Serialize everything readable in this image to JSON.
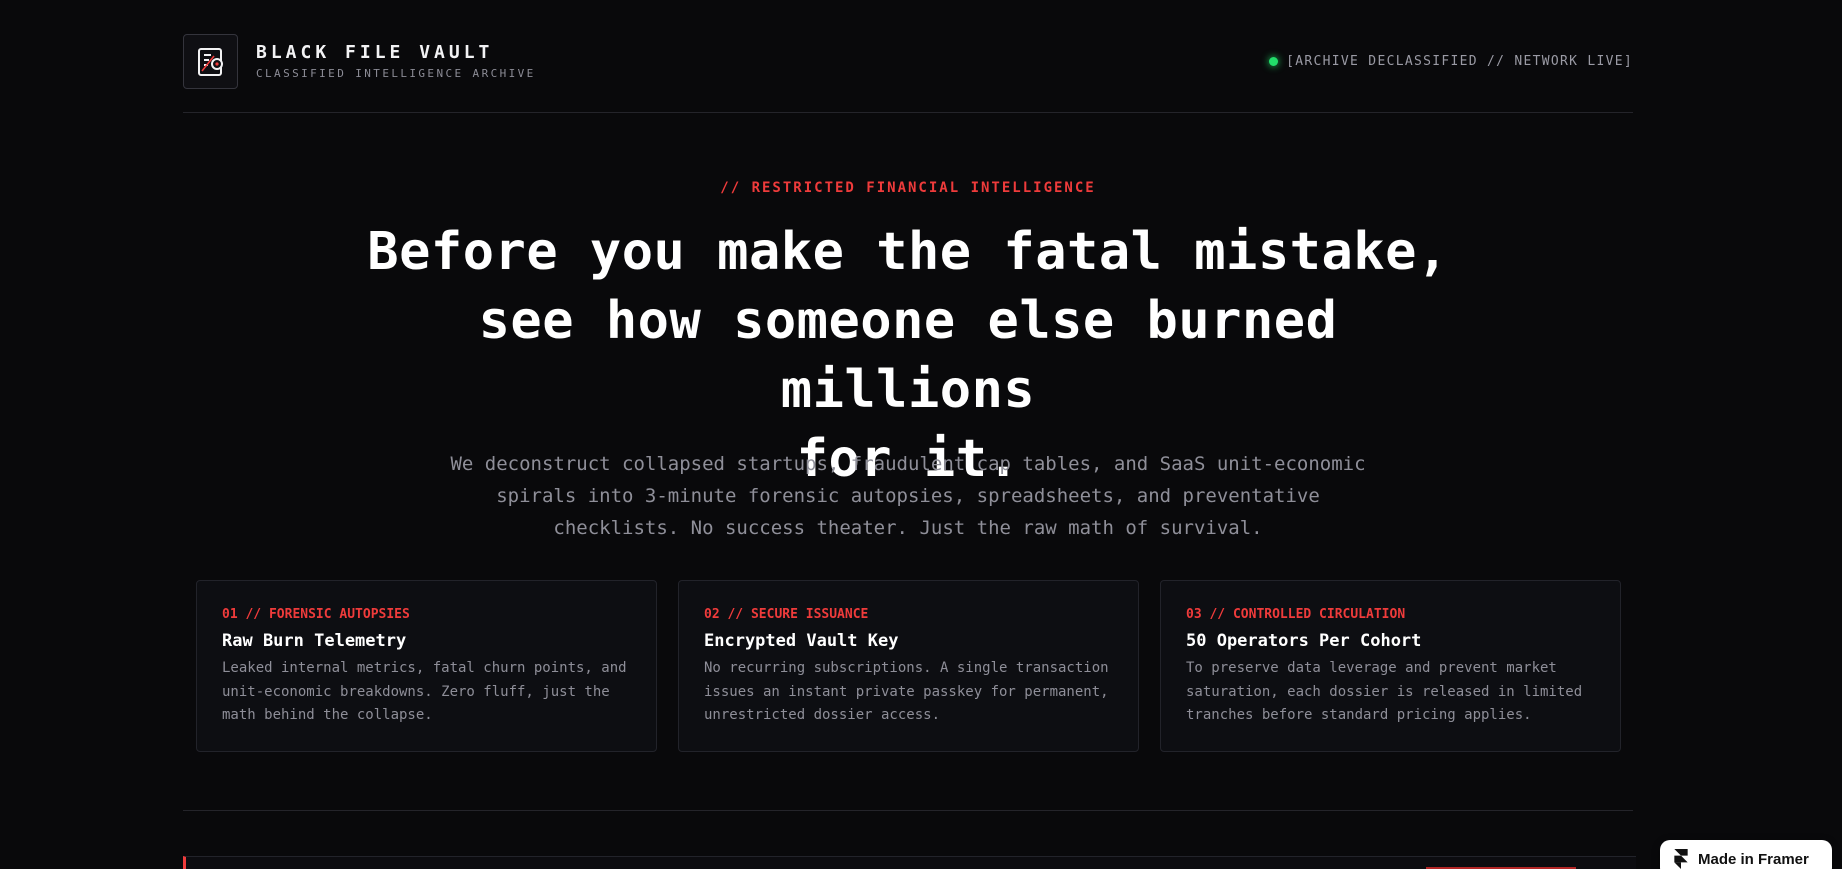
{
  "header": {
    "brand_title": "BLACK FILE VAULT",
    "brand_subtitle": "CLASSIFIED INTELLIGENCE ARCHIVE",
    "logo_icon": "file-dossier-icon",
    "status_text": "[ARCHIVE DECLASSIFIED // NETWORK LIVE]",
    "status_color": "#22dd6a"
  },
  "hero": {
    "eyebrow": "// RESTRICTED FINANCIAL INTELLIGENCE",
    "headline_line1": "Before you make the fatal mistake,",
    "headline_line2": "see how someone else burned millions",
    "headline_line3": "for it.",
    "lede": "We deconstruct collapsed startups, fraudulent cap tables, and SaaS unit-economic spirals into 3-minute forensic autopsies, spreadsheets, and preventative checklists. No success theater. Just the raw math of survival."
  },
  "cards": [
    {
      "tag": "01 // FORENSIC AUTOPSIES",
      "title": "Raw Burn Telemetry",
      "body": "Leaked internal metrics, fatal churn points, and unit-economic breakdowns. Zero fluff, just the math behind the collapse."
    },
    {
      "tag": "02 // SECURE ISSUANCE",
      "title": "Encrypted Vault Key",
      "body": "No recurring subscriptions. A single transaction issues an instant private passkey for permanent, unrestricted dossier access."
    },
    {
      "tag": "03 // CONTROLLED CIRCULATION",
      "title": "50 Operators Per Cohort",
      "body": "To preserve data leverage and prevent market saturation, each dossier is released in limited tranches before standard pricing applies."
    }
  ],
  "framer_badge": {
    "label": "Made in Framer",
    "icon": "framer-logo-icon"
  },
  "colors": {
    "background": "#09090b",
    "accent_red": "#ef3b3b",
    "text_primary": "#ffffff",
    "text_muted": "#8f8f99"
  }
}
